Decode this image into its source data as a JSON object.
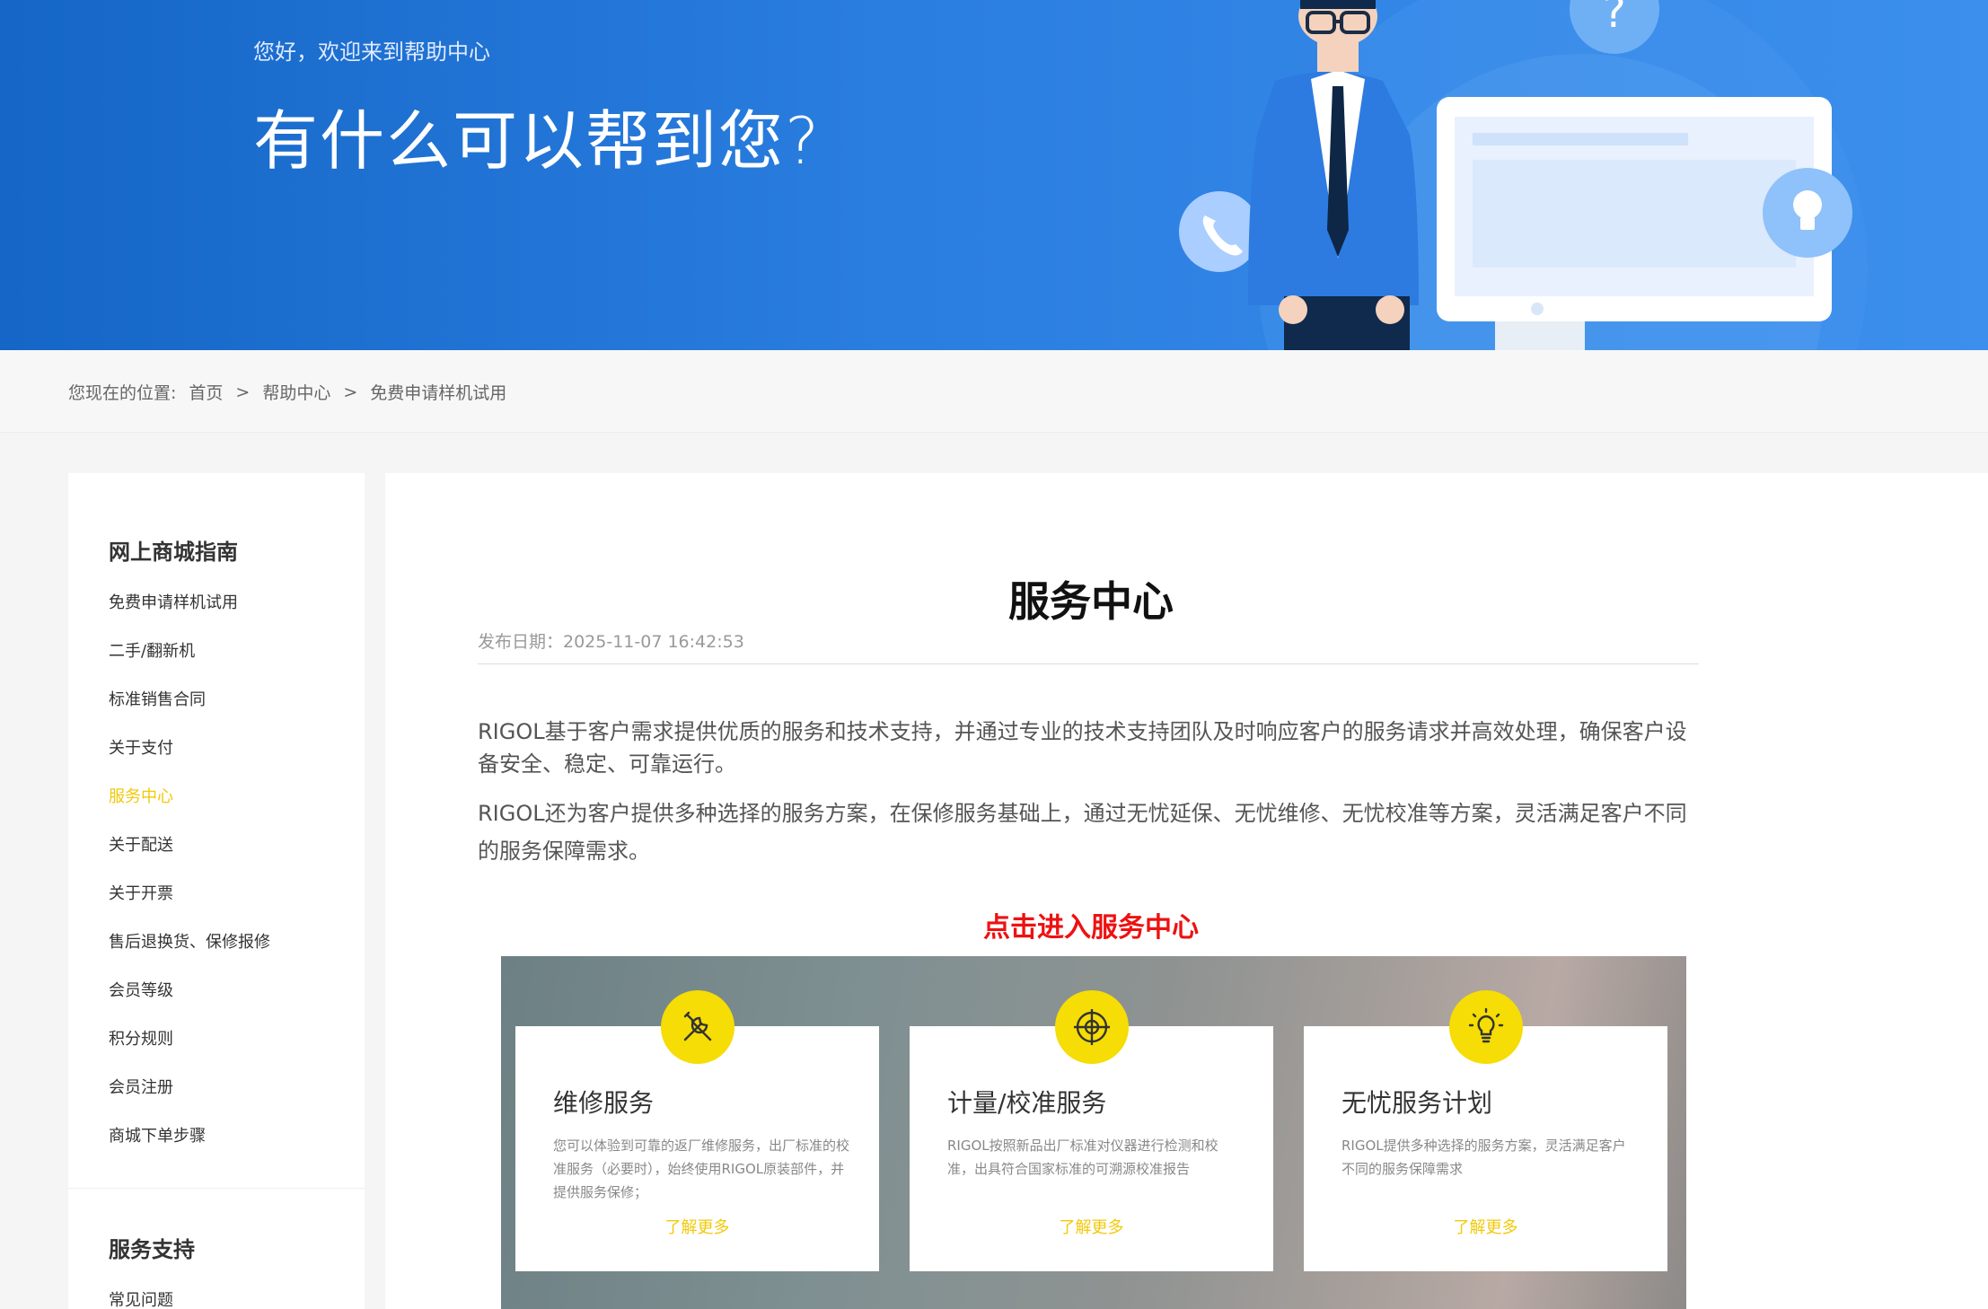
{
  "banner": {
    "greeting": "您好，欢迎来到帮助中心",
    "headline": "有什么可以帮到您?"
  },
  "breadcrumb": {
    "prefix": "您现在的位置:",
    "items": [
      "首页",
      "帮助中心",
      "免费申请样机试用"
    ],
    "separator": ">"
  },
  "sidebar": {
    "groups": [
      {
        "title": "网上商城指南",
        "items": [
          "免费申请样机试用",
          "二手/翻新机",
          "标准销售合同",
          "关于支付",
          "服务中心",
          "关于配送",
          "关于开票",
          "售后退换货、保修报修",
          "会员等级",
          "积分规则",
          "会员注册",
          "商城下单步骤"
        ],
        "active_item": "服务中心"
      },
      {
        "title": "服务支持",
        "items": [
          "常见问题"
        ]
      }
    ]
  },
  "article": {
    "title": "服务中心",
    "date": "发布日期：2025-11-07 16:42:53",
    "paragraphs": [
      "RIGOL基于客户需求提供优质的服务和技术支持，并通过专业的技术支持团队及时响应客户的服务请求并高效处理，确保客户设备安全、稳定、可靠运行。",
      "RIGOL还为客户提供多种选择的服务方案，在保修服务基础上，通过无忧延保、无忧维修、无忧校准等方案，灵活满足客户不同的服务保障需求。"
    ],
    "cta": "点击进入服务中心",
    "cards": [
      {
        "icon": "wrench-screwdriver-icon",
        "title": "维修服务",
        "desc": "您可以体验到可靠的返厂维修服务，出厂标准的校准服务（必要时），始终使用RIGOL原装部件，并提供服务保修；",
        "more": "了解更多"
      },
      {
        "icon": "crosshair-icon",
        "title": "计量/校准服务",
        "desc": "RIGOL按照新品出厂标准对仪器进行检测和校准，出具符合国家标准的可溯源校准报告",
        "more": "了解更多"
      },
      {
        "icon": "lightbulb-icon",
        "title": "无忧服务计划",
        "desc": "RIGOL提供多种选择的服务方案，灵活满足客户不同的服务保障需求",
        "more": "了解更多"
      }
    ]
  },
  "colors": {
    "banner_blue": "#1f72d6",
    "accent_yellow": "#f2c90a",
    "badge_yellow": "#f5dd05",
    "cta_red": "#ee1111"
  }
}
